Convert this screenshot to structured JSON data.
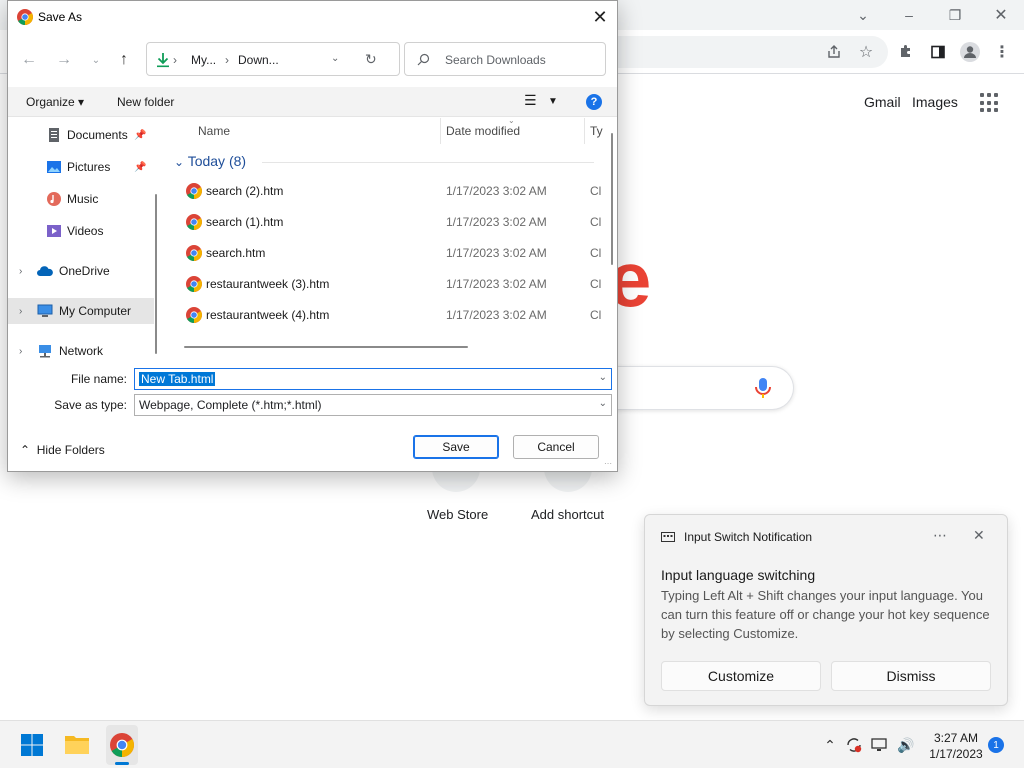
{
  "browser": {
    "links": {
      "gmail": "Gmail",
      "images": "Images"
    },
    "logo_fragment": "e",
    "shortcuts": [
      {
        "label": "Web Store"
      },
      {
        "label": "Add shortcut"
      }
    ]
  },
  "dialog": {
    "title": "Save As",
    "path": {
      "segment1": "My...",
      "segment2": "Down..."
    },
    "search": {
      "placeholder": "Search Downloads"
    },
    "toolbar": {
      "organize": "Organize",
      "new_folder": "New folder"
    },
    "nav": [
      {
        "label": "Documents",
        "pinned": true
      },
      {
        "label": "Pictures",
        "pinned": true
      },
      {
        "label": "Music",
        "pinned": false
      },
      {
        "label": "Videos",
        "pinned": false
      },
      {
        "label": "OneDrive",
        "pinned": false
      },
      {
        "label": "My Computer",
        "pinned": false,
        "selected": true
      },
      {
        "label": "Network",
        "pinned": false
      }
    ],
    "columns": {
      "name": "Name",
      "date": "Date modified",
      "type": "Ty"
    },
    "group": "Today (8)",
    "files": [
      {
        "name": "search (2).htm",
        "date": "1/17/2023 3:02 AM",
        "type": "Cl"
      },
      {
        "name": "search (1).htm",
        "date": "1/17/2023 3:02 AM",
        "type": "Cl"
      },
      {
        "name": "search.htm",
        "date": "1/17/2023 3:02 AM",
        "type": "Cl"
      },
      {
        "name": "restaurantweek (3).htm",
        "date": "1/17/2023 3:02 AM",
        "type": "Cl"
      },
      {
        "name": "restaurantweek (4).htm",
        "date": "1/17/2023 3:02 AM",
        "type": "Cl"
      }
    ],
    "filename": {
      "label": "File name:",
      "value": "New Tab.html"
    },
    "savetype": {
      "label": "Save as type:",
      "value": "Webpage, Complete (*.htm;*.html)"
    },
    "buttons": {
      "save": "Save",
      "cancel": "Cancel",
      "hide_folders": "Hide Folders"
    }
  },
  "notification": {
    "app": "Input Switch Notification",
    "title": "Input language switching",
    "body": "Typing Left Alt + Shift changes your input language. You can turn this feature off or change your hot key sequence by selecting Customize.",
    "buttons": {
      "customize": "Customize",
      "dismiss": "Dismiss"
    }
  },
  "taskbar": {
    "time": "3:27 AM",
    "date": "1/17/2023",
    "badge": "1"
  },
  "colors": {
    "accent": "#1a73e8",
    "selection": "#0078d7",
    "google_red": "#ea4335"
  }
}
